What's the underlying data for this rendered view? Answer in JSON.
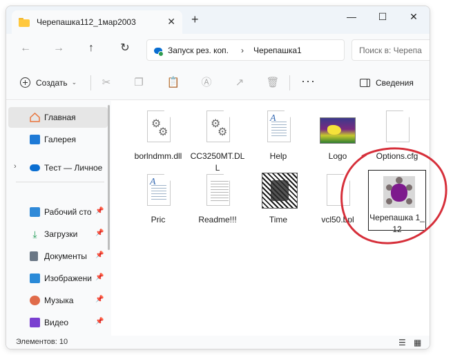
{
  "window": {
    "tab_title": "Черепашка112_1мар2003",
    "tab_close": "✕",
    "new_tab": "+",
    "minimize": "—",
    "maximize": "☐",
    "close": "✕"
  },
  "nav": {
    "back": "←",
    "forward": "→",
    "up": "↑",
    "refresh": "↻",
    "address_root": "Запуск рез. коп.",
    "address_sep": "›",
    "address_current": "Черепашка1",
    "search_placeholder": "Поиск в: Черепа"
  },
  "commandbar": {
    "create_label": "Создать",
    "create_chevron": "⌄",
    "more": "···",
    "details_label": "Сведения"
  },
  "sidebar": {
    "items": [
      {
        "label": "Главная",
        "icon": "home-icon",
        "color": "#e8743b"
      },
      {
        "label": "Галерея",
        "icon": "gallery-icon",
        "color": "#1e7ad6"
      },
      {
        "label": "Тест — Личное",
        "icon": "onedrive-icon",
        "color": "#0a6ed1"
      },
      {
        "label": "Рабочий сто",
        "icon": "desktop-icon",
        "color": "#2f89d8"
      },
      {
        "label": "Загрузки",
        "icon": "download-icon",
        "color": "#1f9a55"
      },
      {
        "label": "Документы",
        "icon": "documents-icon",
        "color": "#6a7785"
      },
      {
        "label": "Изображени",
        "icon": "pictures-icon",
        "color": "#2a8ad8"
      },
      {
        "label": "Музыка",
        "icon": "music-icon",
        "color": "#e06b4a"
      },
      {
        "label": "Видео",
        "icon": "video-icon",
        "color": "#7a3fd0"
      }
    ],
    "pin": "📌",
    "expand": "›"
  },
  "files": [
    {
      "name": "borlndmm.dll",
      "type": "dll"
    },
    {
      "name": "CC3250MT.DLL",
      "type": "dll"
    },
    {
      "name": "Help",
      "type": "doc"
    },
    {
      "name": "Logo",
      "type": "image"
    },
    {
      "name": "Options.cfg",
      "type": "blank"
    },
    {
      "name": "Pric",
      "type": "doc"
    },
    {
      "name": "Readme!!!",
      "type": "text"
    },
    {
      "name": "Time",
      "type": "image"
    },
    {
      "name": "vcl50.bpl",
      "type": "blank"
    },
    {
      "name": "Черепашка 1_12",
      "type": "exe"
    }
  ],
  "status": {
    "count": "Элементов: 10"
  },
  "annotation": {
    "color": "#d62f3a"
  }
}
